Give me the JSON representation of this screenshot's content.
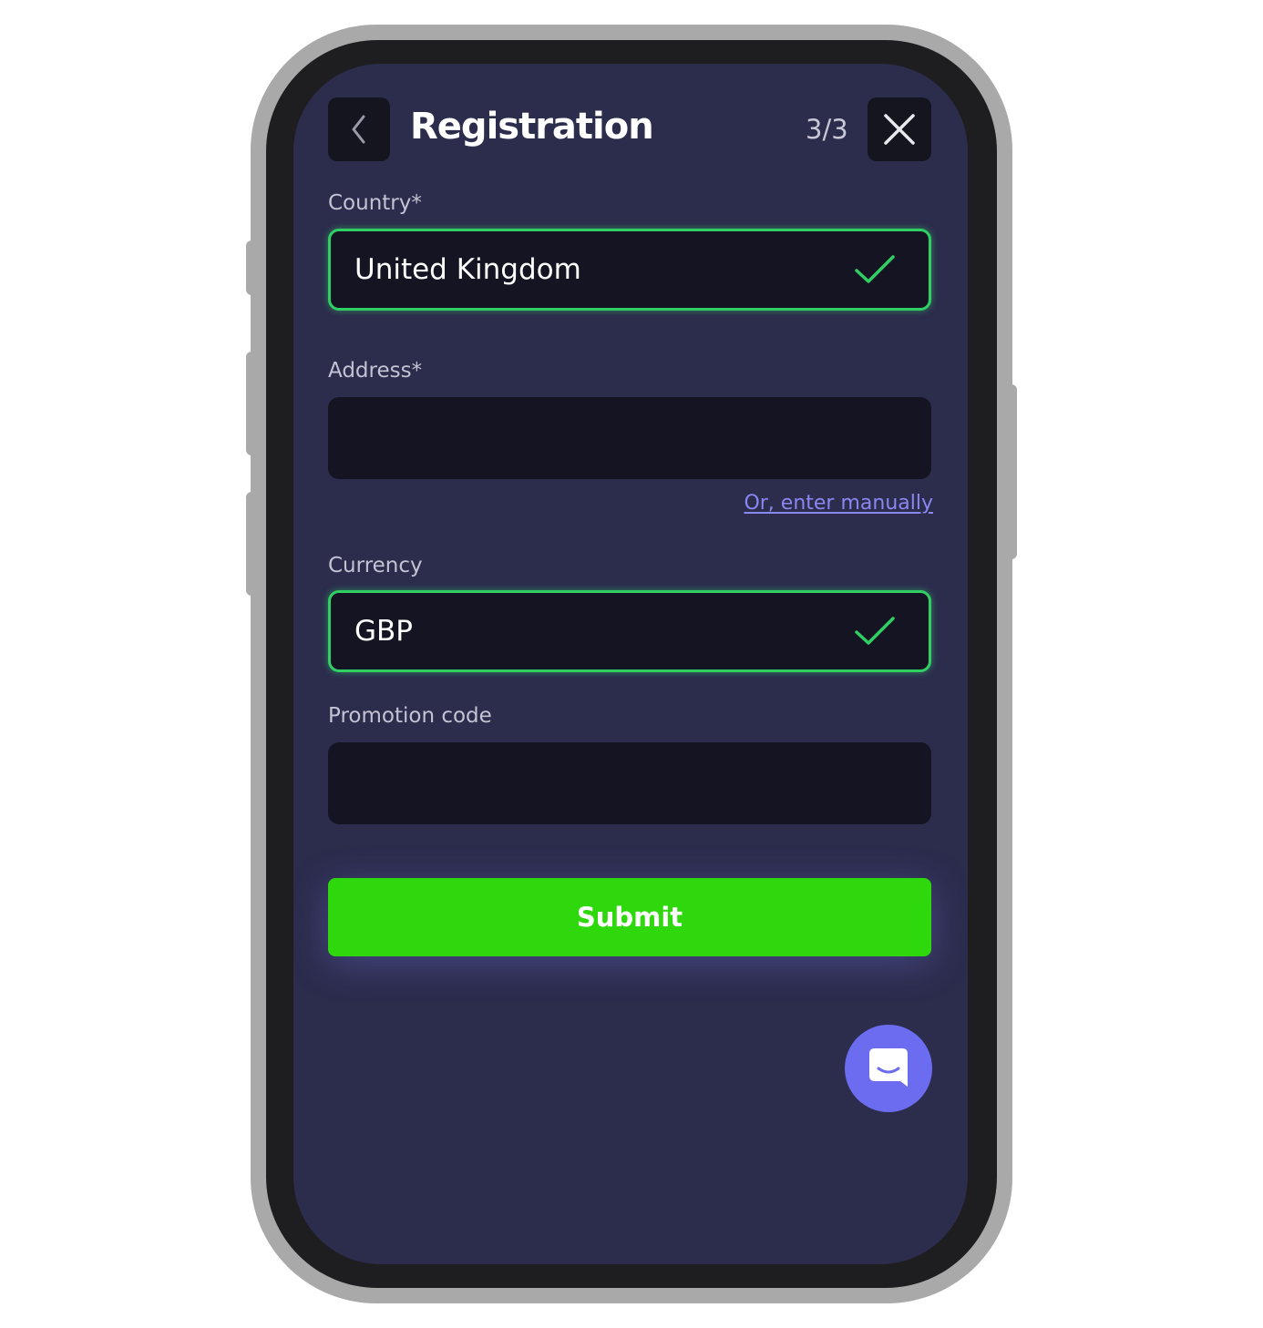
{
  "header": {
    "title": "Registration",
    "step": "3/3"
  },
  "form": {
    "country": {
      "label": "Country*",
      "value": "United Kingdom",
      "status": "valid"
    },
    "address": {
      "label": "Address*",
      "value": "",
      "manual_link": "Or, enter manually"
    },
    "currency": {
      "label": "Currency",
      "value": "GBP",
      "status": "valid"
    },
    "promotion": {
      "label": "Promotion code",
      "value": ""
    },
    "submit_label": "Submit"
  },
  "colors": {
    "background": "#2c2c4d",
    "field": "#141422",
    "valid_border": "#2fcf63",
    "submit": "#2ed80d",
    "link": "#8a87f0",
    "chat_fab": "#6c6cf0"
  },
  "icons": {
    "back": "chevron-left-icon",
    "close": "close-icon",
    "valid": "check-icon",
    "chat": "chat-icon"
  }
}
